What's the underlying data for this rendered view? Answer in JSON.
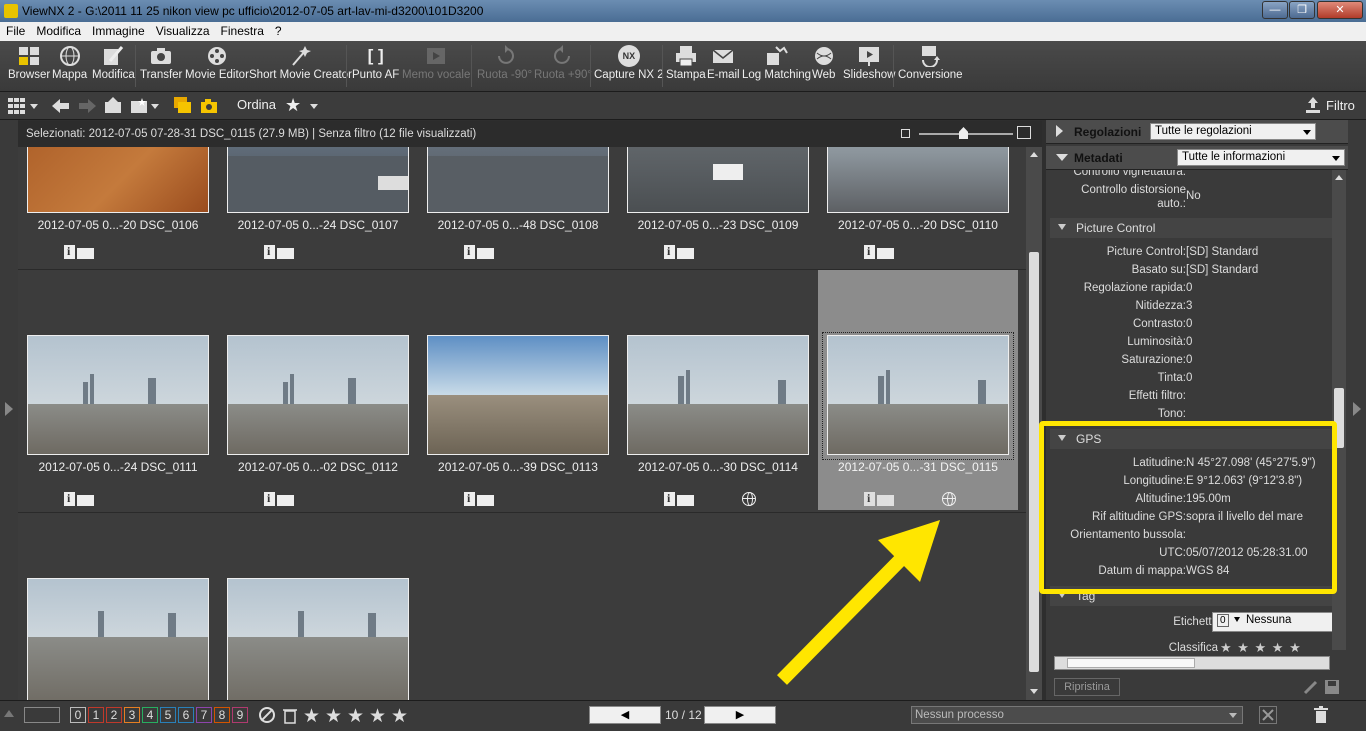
{
  "window": {
    "title": "ViewNX 2 - G:\\2011 11 25 nikon view pc ufficio\\2012-07-05 art-lav-mi-d3200\\101D3200",
    "controls": {
      "minimize": "—",
      "maximize": "❐",
      "close": "✕"
    }
  },
  "menu": [
    "File",
    "Modifica",
    "Immagine",
    "Visualizza",
    "Finestra",
    "?"
  ],
  "toolbar": {
    "browser": "Browser",
    "mappa": "Mappa",
    "modifica": "Modifica",
    "transfer": "Transfer",
    "movie_editor": "Movie Editor",
    "short_movie": "Short Movie Creator",
    "punto_af": "Punto AF",
    "memo_vocale": "Memo vocale",
    "ruota_minus": "Ruota -90°",
    "ruota_plus": "Ruota +90°",
    "capture_nx": "Capture NX 2",
    "stampa": "Stampa",
    "email": "E-mail",
    "log_matching": "Log Matching",
    "web": "Web",
    "slideshow": "Slideshow",
    "conversione": "Conversione",
    "punto_af_glyph": "[ ]",
    "nx_glyph": "NX"
  },
  "toolbar2": {
    "ordina": "Ordina",
    "filtro": "Filtro"
  },
  "selection_info": "Selezionati: 2012-07-05 07-28-31 DSC_0115 (27.9 MB) | Senza filtro (12 file visualizzati)",
  "thumbnails": [
    {
      "caption": "2012-07-05 0...-20 DSC_0106"
    },
    {
      "caption": "2012-07-05 0...-24 DSC_0107"
    },
    {
      "caption": "2012-07-05 0...-48 DSC_0108"
    },
    {
      "caption": "2012-07-05 0...-23 DSC_0109"
    },
    {
      "caption": "2012-07-05 0...-20 DSC_0110"
    },
    {
      "caption": "2012-07-05 0...-24 DSC_0111"
    },
    {
      "caption": "2012-07-05 0...-02 DSC_0112"
    },
    {
      "caption": "2012-07-05 0...-39 DSC_0113"
    },
    {
      "caption": "2012-07-05 0...-30 DSC_0114"
    },
    {
      "caption": "2012-07-05 0...-31 DSC_0115"
    }
  ],
  "panel": {
    "regolazioni": {
      "label": "Regolazioni",
      "select": "Tutte le regolazioni"
    },
    "metadati": {
      "label": "Metadati",
      "select": "Tutte le informazioni"
    },
    "lens_rows": [
      {
        "k": "Controllo vignettatura:",
        "v": ""
      },
      {
        "k": "Controllo distorsione",
        "v": "No"
      },
      {
        "k": "auto.:",
        "v": ""
      }
    ],
    "picture_control": {
      "title": "Picture Control",
      "rows": [
        {
          "k": "Picture Control:",
          "v": "[SD] Standard"
        },
        {
          "k": "Basato su:",
          "v": "[SD] Standard"
        },
        {
          "k": "Regolazione rapida:",
          "v": "0"
        },
        {
          "k": "Nitidezza:",
          "v": "3"
        },
        {
          "k": "Contrasto:",
          "v": "0"
        },
        {
          "k": "Luminosità:",
          "v": "0"
        },
        {
          "k": "Saturazione:",
          "v": "0"
        },
        {
          "k": "Tinta:",
          "v": "0"
        },
        {
          "k": "Effetti filtro:",
          "v": ""
        },
        {
          "k": "Tono:",
          "v": ""
        }
      ]
    },
    "gps": {
      "title": "GPS",
      "rows": [
        {
          "k": "Latitudine:",
          "v": "N 45°27.098' (45°27'5.9\")"
        },
        {
          "k": "Longitudine:",
          "v": "E 9°12.063' (9°12'3.8\")"
        },
        {
          "k": "Altitudine:",
          "v": "195.00m"
        },
        {
          "k": "Rif altitudine GPS:",
          "v": "sopra il livello del mare"
        },
        {
          "k": "Orientamento bussola:",
          "v": ""
        },
        {
          "k": "UTC:",
          "v": "05/07/2012 05:28:31.00"
        },
        {
          "k": "Datum di mappa:",
          "v": "WGS 84"
        }
      ]
    },
    "tag": {
      "title": "Tag",
      "etichetta_k": "Etichetta",
      "etichetta_num": "0",
      "etichetta_v": "Nessuna",
      "classifica_k": "Classifica",
      "stars": "★ ★ ★ ★ ★"
    },
    "ripristina": "Ripristina"
  },
  "statusbar": {
    "labels": [
      "0",
      "1",
      "2",
      "3",
      "4",
      "5",
      "6",
      "7",
      "8",
      "9"
    ],
    "label_colors": [
      "#888888",
      "#c0392b",
      "#c0392b",
      "#e67e22",
      "#27ae60",
      "#2980b9",
      "#2980b9",
      "#8e44ad",
      "#d35400",
      "#b03a6f"
    ],
    "star_glyph": "★",
    "prev": "◀",
    "next": "▶",
    "page": "10 / 12",
    "process": "Nessun processo"
  },
  "colors": {
    "highlight": "#ffe600",
    "selected_cell": "#8c8c8c"
  }
}
